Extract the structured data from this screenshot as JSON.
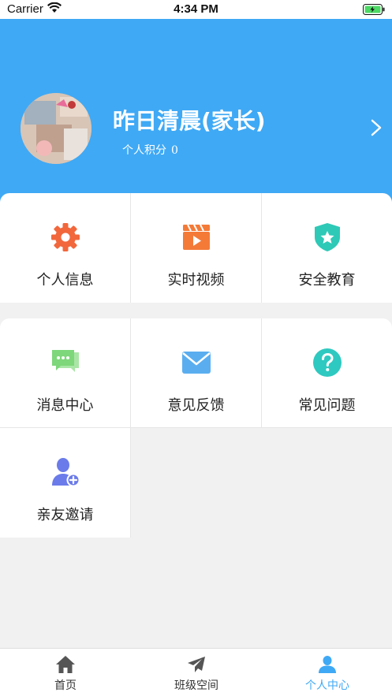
{
  "status_bar": {
    "carrier": "Carrier",
    "time": "4:34 PM"
  },
  "profile": {
    "name": "昨日清晨(家长)",
    "points_label": "个人积分",
    "points_value": "0"
  },
  "grid_section_1": [
    {
      "label": "个人信息",
      "icon": "gear-icon",
      "color": "#f2673c"
    },
    {
      "label": "实时视频",
      "icon": "video-clapper-icon",
      "color": "#f47a38"
    },
    {
      "label": "安全教育",
      "icon": "shield-star-icon",
      "color": "#2ec9b7"
    }
  ],
  "grid_section_2": [
    {
      "label": "消息中心",
      "icon": "message-icon",
      "color": "#7ed77a"
    },
    {
      "label": "意见反馈",
      "icon": "mail-icon",
      "color": "#5aaef0"
    },
    {
      "label": "常见问题",
      "icon": "question-icon",
      "color": "#2ec9c0"
    },
    {
      "label": "亲友邀请",
      "icon": "add-user-icon",
      "color": "#6b7bea"
    }
  ],
  "tabbar": [
    {
      "label": "首页",
      "icon": "home-icon"
    },
    {
      "label": "班级空间",
      "icon": "paper-plane-icon"
    },
    {
      "label": "个人中心",
      "icon": "user-icon",
      "active": true
    }
  ],
  "colors": {
    "accent": "#3fa9f5",
    "background": "#f1f1f1"
  }
}
